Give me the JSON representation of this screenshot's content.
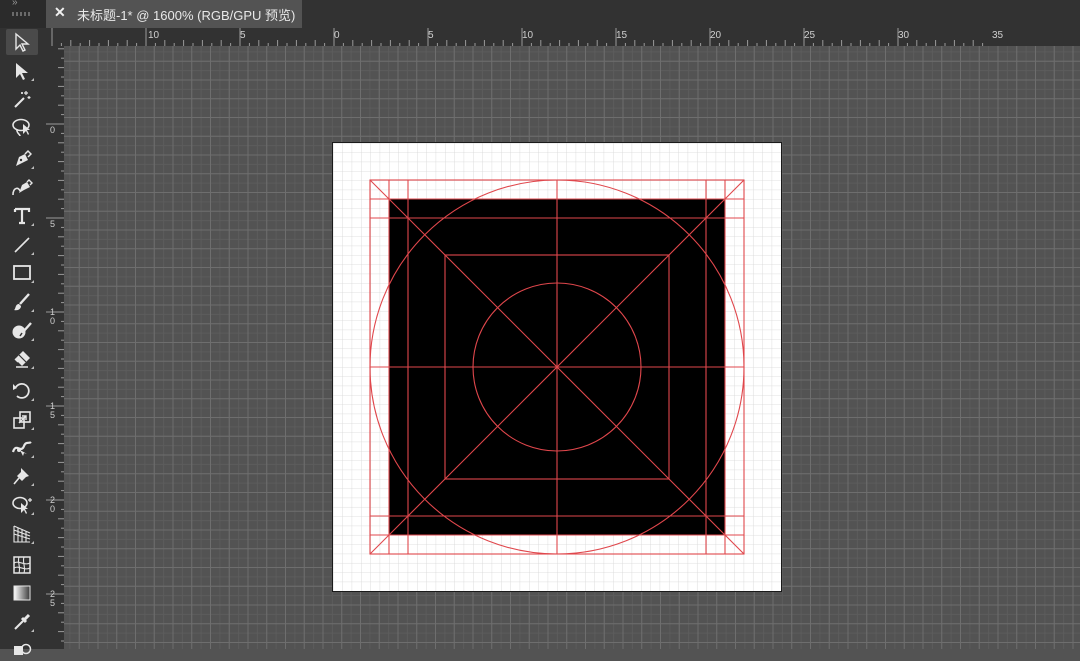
{
  "window": {
    "collapse_label": "»",
    "tab": {
      "close_icon": "close-icon",
      "title": "未标题-1* @ 1600% (RGB/GPU 预览)"
    }
  },
  "rulers": {
    "horizontal": [
      "10",
      "5",
      "0",
      "5",
      "10",
      "15",
      "20",
      "25",
      "30",
      "35"
    ],
    "vertical": [
      "0",
      "5",
      "10",
      "15",
      "20",
      "25"
    ]
  },
  "toolbar": {
    "tools": [
      {
        "name": "selection-tool-icon"
      },
      {
        "name": "direct-selection-tool-icon"
      },
      {
        "name": "magic-wand-tool-icon"
      },
      {
        "name": "lasso-tool-icon"
      },
      {
        "name": "pen-tool-icon"
      },
      {
        "name": "curvature-tool-icon"
      },
      {
        "name": "type-tool-icon",
        "glyph": "T"
      },
      {
        "name": "line-segment-tool-icon"
      },
      {
        "name": "rectangle-tool-icon"
      },
      {
        "name": "paintbrush-tool-icon"
      },
      {
        "name": "shaper-tool-icon"
      },
      {
        "name": "eraser-tool-icon"
      },
      {
        "name": "rotate-tool-icon"
      },
      {
        "name": "scale-tool-icon"
      },
      {
        "name": "width-tool-icon"
      },
      {
        "name": "puppet-warp-tool-icon"
      },
      {
        "name": "shape-builder-tool-icon"
      },
      {
        "name": "perspective-grid-tool-icon"
      },
      {
        "name": "mesh-tool-icon"
      },
      {
        "name": "gradient-tool-icon"
      },
      {
        "name": "eyedropper-tool-icon"
      },
      {
        "name": "blend-tool-icon"
      }
    ]
  },
  "canvas": {
    "zoom": "1600%",
    "colors": {
      "workspace": "#535353",
      "artboard": "#ffffff",
      "icon_fill": "#000000",
      "keyline": "#e0474c"
    }
  }
}
